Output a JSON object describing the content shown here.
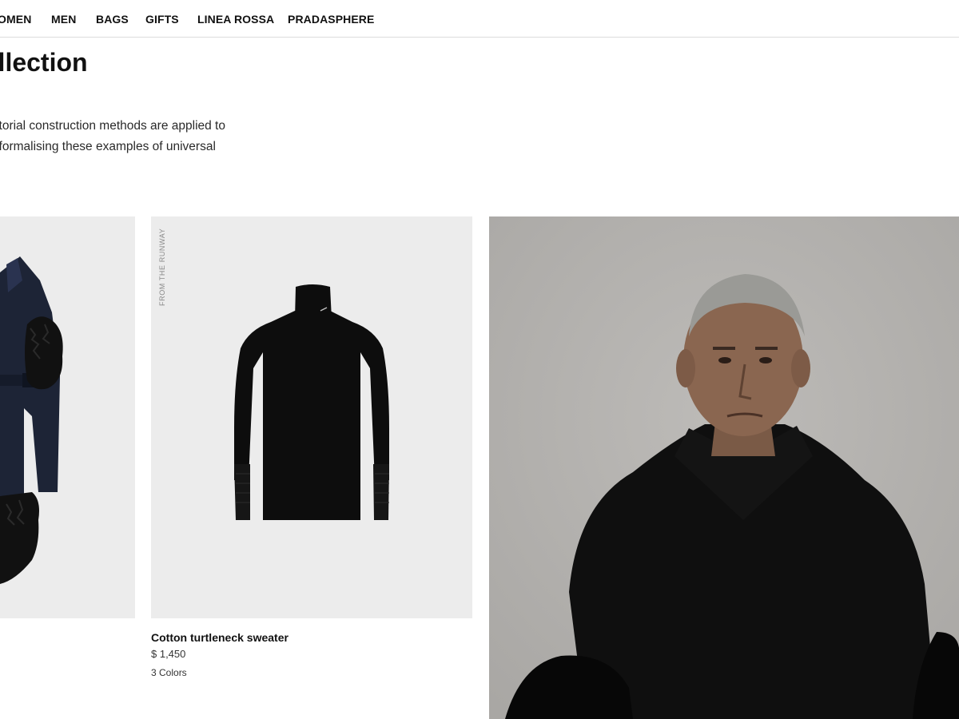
{
  "nav": {
    "items": [
      {
        "label": "OMEN"
      },
      {
        "label": "MEN"
      },
      {
        "label": "BAGS"
      },
      {
        "label": "GIFTS"
      },
      {
        "label": "LINEA ROSSA"
      },
      {
        "label": "PRADASPHERE"
      }
    ]
  },
  "page": {
    "title": "ollection",
    "intro_lines": [
      "ce, sartorial construction methods are applied to",
      "arkas, formalising these examples of universal"
    ]
  },
  "products": [
    {
      "image_icon": "navy-fur-trim-coat-image"
    },
    {
      "image_icon": "black-turtleneck-sweater-image",
      "tag": "FROM THE RUNWAY",
      "name": "Cotton turtleneck sweater",
      "price": "$ 1,450",
      "colors": "3 Colors"
    }
  ],
  "editorial": {
    "image_icon": "model-in-black-coat-photo"
  },
  "colors": {
    "text": "#111111",
    "card_bg": "#ececec",
    "divider": "#dcdcdc",
    "coat_navy": "#1d2436"
  }
}
